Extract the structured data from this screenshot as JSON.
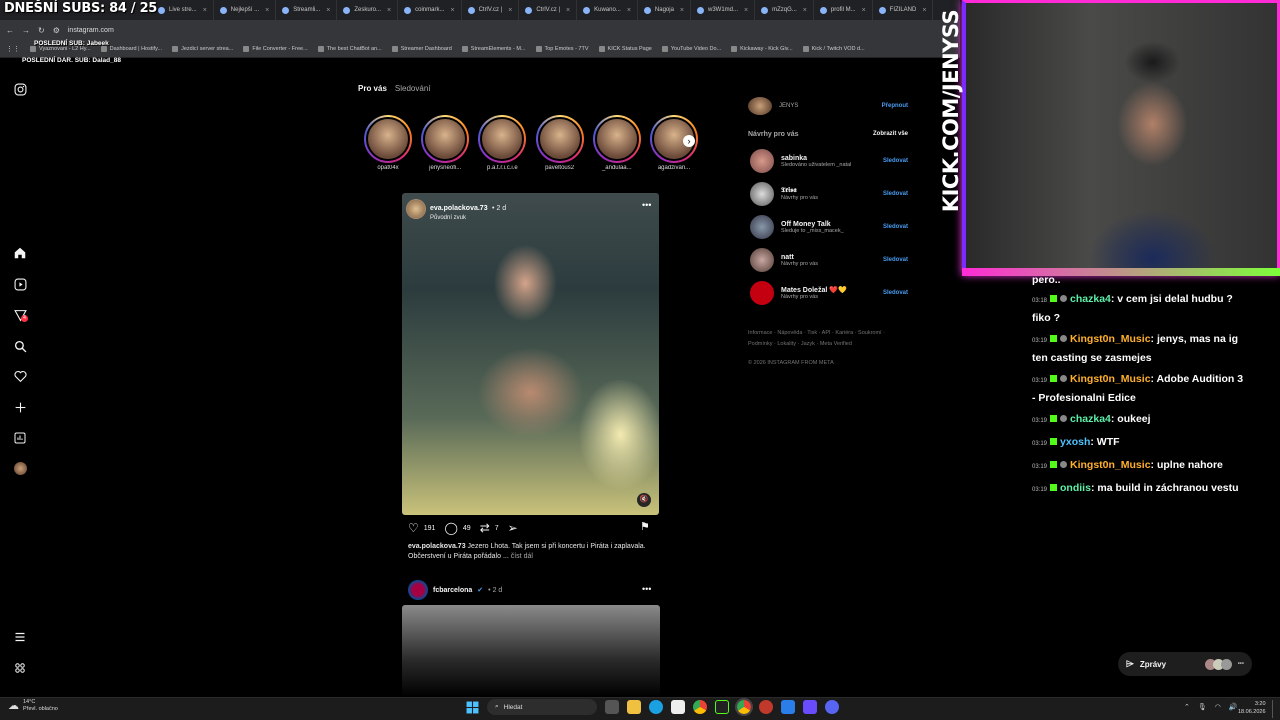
{
  "overlay": {
    "subs_title": "DNEŠNÍ SUBS: 84 / 25",
    "last_sub": "POSLEDNÍ SUB: Jabeek",
    "last_gift": "POSLEDNÍ DAR. SUB: Dalad_88",
    "cam_label": "KICK.COM/JENYSS"
  },
  "browser": {
    "tabs": [
      "Live stre...",
      "Nejlepší ...",
      "Streamli...",
      "Zeskuro...",
      "coinmark...",
      "CtrlV.cz |",
      "CtrlV.cz |",
      "Kuwano...",
      "Nagoja",
      "w3W1md...",
      "mZzqG...",
      "profil M...",
      "FIZILAND"
    ],
    "url": "instagram.com",
    "bookmarks": [
      "Vyaznovani - L2 Hy...",
      "Dashboard | Hostify...",
      "Jezdicí server strea...",
      "File Converter - Free...",
      "The best ChatBot an...",
      "Streamer Dashboard",
      "StreamElements - M...",
      "Top Emotes - 7TV",
      "KICK Status Page",
      "YouTube Video Do...",
      "Kickaway - Kick Giv...",
      "Kick / Twitch VOD d..."
    ]
  },
  "feed": {
    "tab_for_you": "Pro vás",
    "tab_following": "Sledování",
    "stories": [
      "opat04x",
      "jenysneofi...",
      "p.a.t.r.i.c.i.e",
      "paveltous2",
      "_andulaa...",
      "agadzivan..."
    ],
    "post": {
      "author": "eva.polackova.73",
      "age": "• 2 d",
      "audio": "Původní zvuk",
      "likes": "191",
      "comments": "49",
      "shares": "7",
      "caption_user": "eva.polackova.73",
      "caption_text": "Jezero Lhota. Tak jsem si při koncertu i Piráta i zaplavala. Občerstvení u Piráta pořádalo ...",
      "more": "číst dál"
    },
    "post2": {
      "author": "fcbarcelona",
      "age": "• 2 d"
    }
  },
  "sidebar": {
    "me_name": "JENYS",
    "switch": "Přepnout",
    "suggestions_title": "Návrhy pro vás",
    "see_all": "Zobrazit vše",
    "follow": "Sledovat",
    "suggestions": [
      {
        "name": "sabinka",
        "desc": "Sledováno uživatelem _natal"
      },
      {
        "name": "𝕿𝖗𝖎𝖘𝖆",
        "desc": "Návrhy pro vás"
      },
      {
        "name": "Off Money Talk",
        "desc": "Sleduje to _miss_macek_"
      },
      {
        "name": "natt",
        "desc": "Návrhy pro vás"
      },
      {
        "name": "Mates Doležal ❤️💛",
        "desc": "Návrhy pro vás"
      }
    ],
    "footer_links": "Informace · Nápověda · Tisk · API · Kariéra · Soukromí · Podmínky · Lokality · Jazyk · Meta Verified",
    "copyright": "© 2026 INSTAGRAM FROM META"
  },
  "chat": {
    "partial": "pero..",
    "messages": [
      {
        "time": "03:18",
        "user": "chazka4",
        "color": "green",
        "text": ": v cem jsi delal hudbu ? fiko ?"
      },
      {
        "time": "03:19",
        "user": "Kingst0n_Music",
        "color": "orange",
        "text": ": jenys, mas na ig ten casting se zasmejes"
      },
      {
        "time": "03:19",
        "user": "Kingst0n_Music",
        "color": "orange",
        "text": ": Adobe Audition 3 - Profesionalni Edice"
      },
      {
        "time": "03:19",
        "user": "chazka4",
        "color": "green",
        "text": ": oukeej"
      },
      {
        "time": "03:19",
        "user": "yxosh",
        "color": "blue",
        "text": ": WTF"
      },
      {
        "time": "03:19",
        "user": "Kingst0n_Music",
        "color": "orange",
        "text": ": uplne nahore"
      },
      {
        "time": "03:19",
        "user": "ondiis",
        "color": "green",
        "text": ": ma build in záchranou vestu"
      }
    ],
    "messages_button": "Zprávy"
  },
  "taskbar": {
    "temp": "14°C",
    "weather": "Převl. oblačno",
    "search": "Hledat",
    "time": "3:20",
    "date": "18.06.2026"
  }
}
